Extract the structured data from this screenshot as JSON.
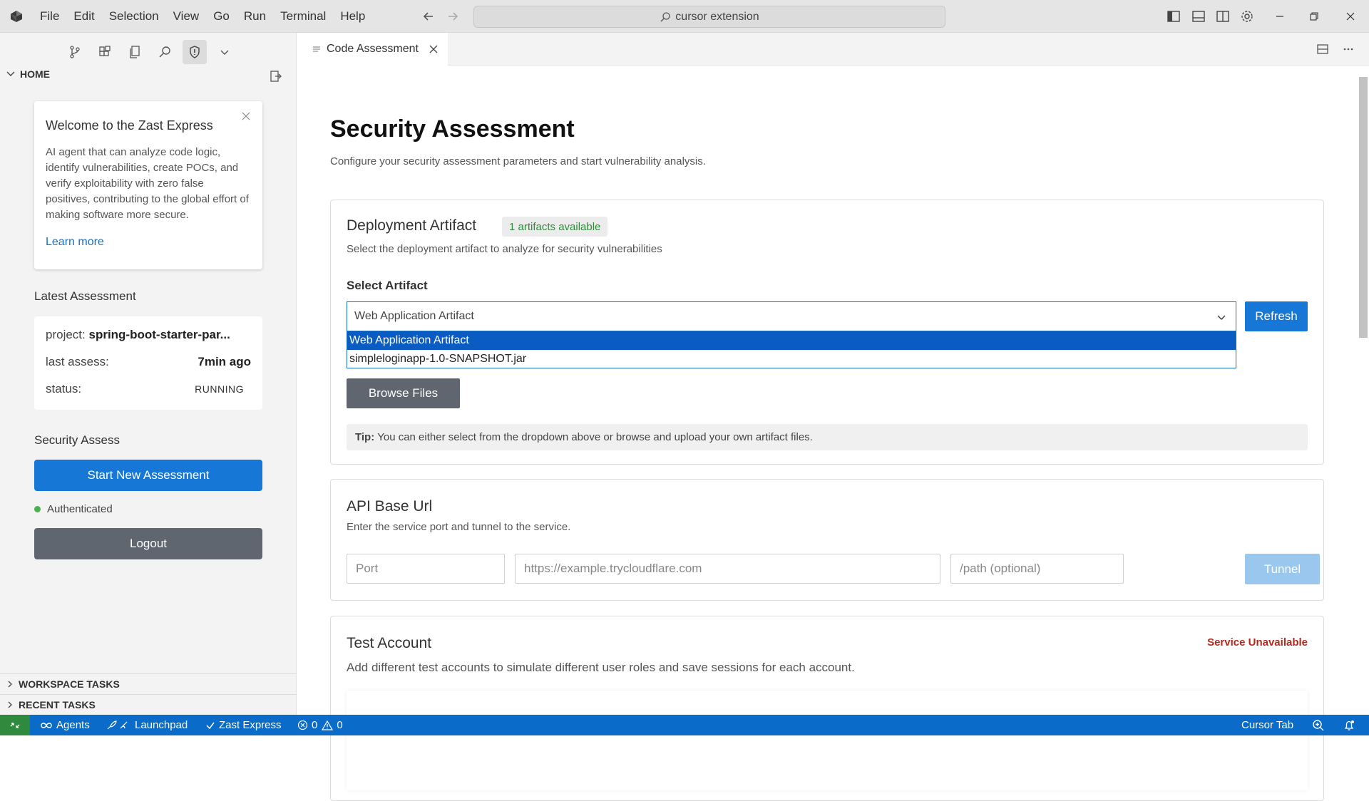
{
  "titlebar": {
    "menu": [
      "File",
      "Edit",
      "Selection",
      "View",
      "Go",
      "Run",
      "Terminal",
      "Help"
    ],
    "search_text": "cursor extension"
  },
  "sidebar": {
    "home_label": "HOME",
    "welcome": {
      "title": "Welcome to the Zast Express",
      "body": "AI agent that can analyze code logic, identify vulnerabilities, create POCs, and verify exploitability with zero false positives, contributing to the global effort of making software more secure.",
      "link": "Learn more"
    },
    "latest": {
      "heading": "Latest Assessment",
      "project_label": "project:",
      "project_value": "spring-boot-starter-par...",
      "last_label": "last assess:",
      "last_value": "7min ago",
      "status_label": "status:",
      "status_value": "RUNNING"
    },
    "security": {
      "heading": "Security Assess",
      "start_button": "Start New Assessment",
      "auth_status": "Authenticated",
      "logout_button": "Logout"
    },
    "sections": [
      "WORKSPACE TASKS",
      "RECENT TASKS"
    ]
  },
  "editor": {
    "tab_label": "Code Assessment",
    "title": "Security Assessment",
    "subtitle": "Configure your security assessment parameters and start vulnerability analysis.",
    "deployment": {
      "title": "Deployment Artifact",
      "badge": "1 artifacts available",
      "description": "Select the deployment artifact to analyze for security vulnerabilities",
      "select_label": "Select Artifact",
      "selected_value": "Web Application Artifact",
      "options": [
        "Web Application Artifact",
        "simpleloginapp-1.0-SNAPSHOT.jar"
      ],
      "refresh_button": "Refresh",
      "browse_button": "Browse Files",
      "tip_label": "Tip:",
      "tip_text": "You can either select from the dropdown above or browse and upload your own artifact files."
    },
    "api": {
      "title": "API Base Url",
      "description": "Enter the service port and tunnel to the service.",
      "port_placeholder": "Port",
      "url_placeholder": "https://example.trycloudflare.com",
      "path_placeholder": "/path (optional)",
      "tunnel_button": "Tunnel"
    },
    "test_account": {
      "title": "Test Account",
      "description": "Add different test accounts to simulate different user roles and save sessions for each account.",
      "service_status": "Service Unavailable"
    }
  },
  "statusbar": {
    "agents": "Agents",
    "launchpad": "Launchpad",
    "zast": "Zast Express",
    "errors": "0",
    "warnings": "0",
    "cursor_tab": "Cursor Tab"
  },
  "colors": {
    "accent": "#1677d6",
    "statusbar": "#0a6bc9",
    "remote": "#2f8a3e",
    "secondary_button": "#5f6670",
    "error": "#b22a1e",
    "success": "#2e8b3a"
  }
}
